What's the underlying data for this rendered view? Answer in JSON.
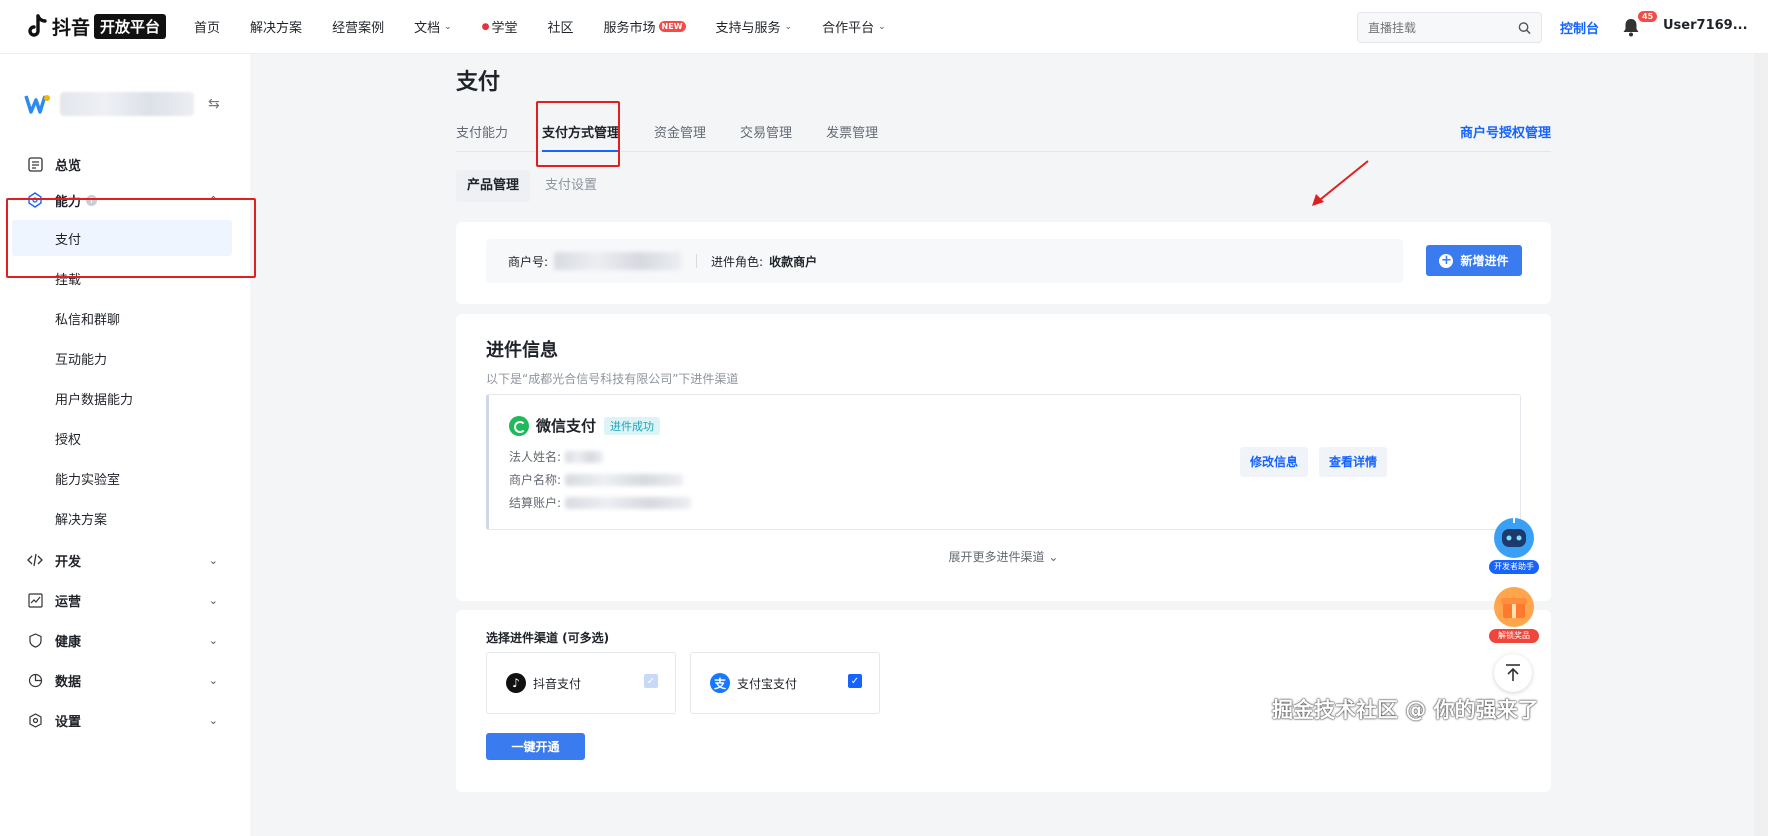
{
  "header": {
    "logo_text": "抖音",
    "logo_badge": "开放平台",
    "nav": [
      {
        "label": "首页",
        "chevron": false
      },
      {
        "label": "解决方案",
        "chevron": false
      },
      {
        "label": "经营案例",
        "chevron": false
      },
      {
        "label": "文档",
        "chevron": true
      },
      {
        "label": "学堂",
        "chevron": false,
        "dot": true
      },
      {
        "label": "社区",
        "chevron": false
      },
      {
        "label": "服务市场",
        "chevron": false,
        "badge": "NEW"
      },
      {
        "label": "支持与服务",
        "chevron": true
      },
      {
        "label": "合作平台",
        "chevron": true
      }
    ],
    "search_placeholder": "直播挂载",
    "console": "控制台",
    "notifications": "45",
    "user": "User7169..."
  },
  "sidebar": {
    "menu": [
      {
        "label": "总览",
        "icon": "overview-icon"
      },
      {
        "label": "能力",
        "icon": "capability-icon",
        "expanded": true
      }
    ],
    "sub_items": [
      "支付",
      "挂载",
      "私信和群聊",
      "互动能力",
      "用户数据能力",
      "授权",
      "能力实验室",
      "解决方案"
    ],
    "menu_bottom": [
      {
        "label": "开发",
        "icon": "code-icon"
      },
      {
        "label": "运营",
        "icon": "operation-icon"
      },
      {
        "label": "健康",
        "icon": "health-icon"
      },
      {
        "label": "数据",
        "icon": "data-icon"
      },
      {
        "label": "设置",
        "icon": "settings-icon"
      }
    ]
  },
  "page": {
    "title": "支付",
    "tabs": [
      "支付能力",
      "支付方式管理",
      "资金管理",
      "交易管理",
      "发票管理"
    ],
    "active_tab": 1,
    "tab_right": "商户号授权管理",
    "subtabs": [
      "产品管理",
      "支付设置"
    ],
    "merchant": {
      "id_label": "商户号:",
      "role_label": "进件角色:",
      "role_value": "收款商户",
      "add_button": "新增进件"
    },
    "info": {
      "title": "进件信息",
      "subtitle": "以下是“成都光合信号科技有限公司”下进件渠道",
      "channel_name": "微信支付",
      "status": "进件成功",
      "fields": [
        "法人姓名:",
        "商户名称:",
        "结算账户:"
      ],
      "edit_button": "修改信息",
      "detail_button": "查看详情",
      "expand": "展开更多进件渠道"
    },
    "channels": {
      "title": "选择进件渠道 (可多选)",
      "options": [
        {
          "label": "抖音支付",
          "checked": true,
          "disabled": true
        },
        {
          "label": "支付宝支付",
          "checked": true,
          "disabled": false
        }
      ],
      "submit": "一键开通"
    }
  },
  "floating": {
    "assistant": "开发者助手",
    "reward": "解锁奖品"
  },
  "watermark": "掘金技术社区 @ 你的强来了",
  "colors": {
    "primary": "#1664ff",
    "button": "#3a7bef",
    "highlight": "#e02020"
  }
}
